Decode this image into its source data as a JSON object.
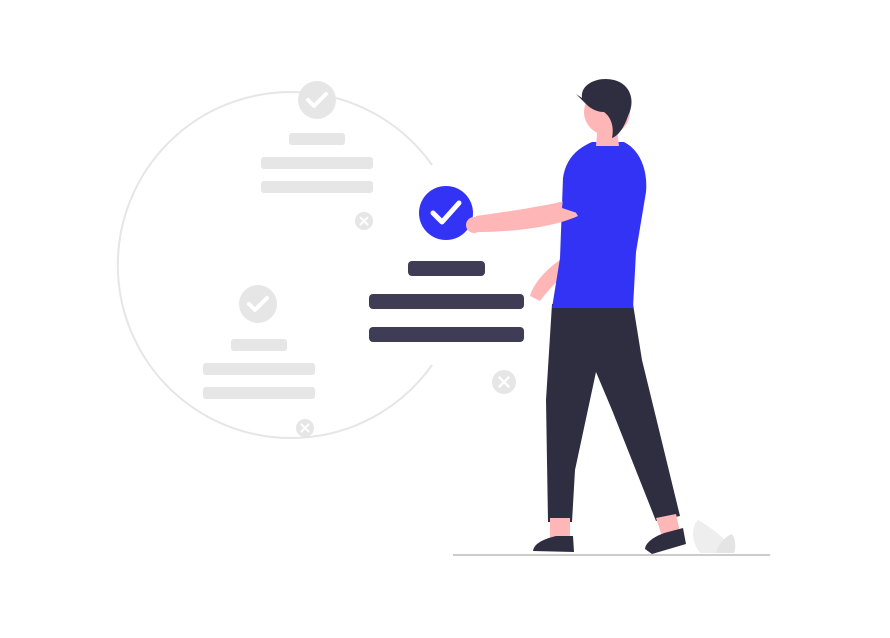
{
  "illustration": {
    "subject": "person-selecting-option",
    "colors": {
      "background": "#ffffff",
      "accent": "#3333f5",
      "dark": "#3f3d56",
      "pants": "#2f2e41",
      "hair": "#2f2e41",
      "skin": "#ffb6b6",
      "muted": "#e6e6e6",
      "muted_check": "#ffffff",
      "ground": "#cccccc",
      "plant": "#eeeeee"
    },
    "icons": [
      "check-icon",
      "close-icon"
    ]
  }
}
